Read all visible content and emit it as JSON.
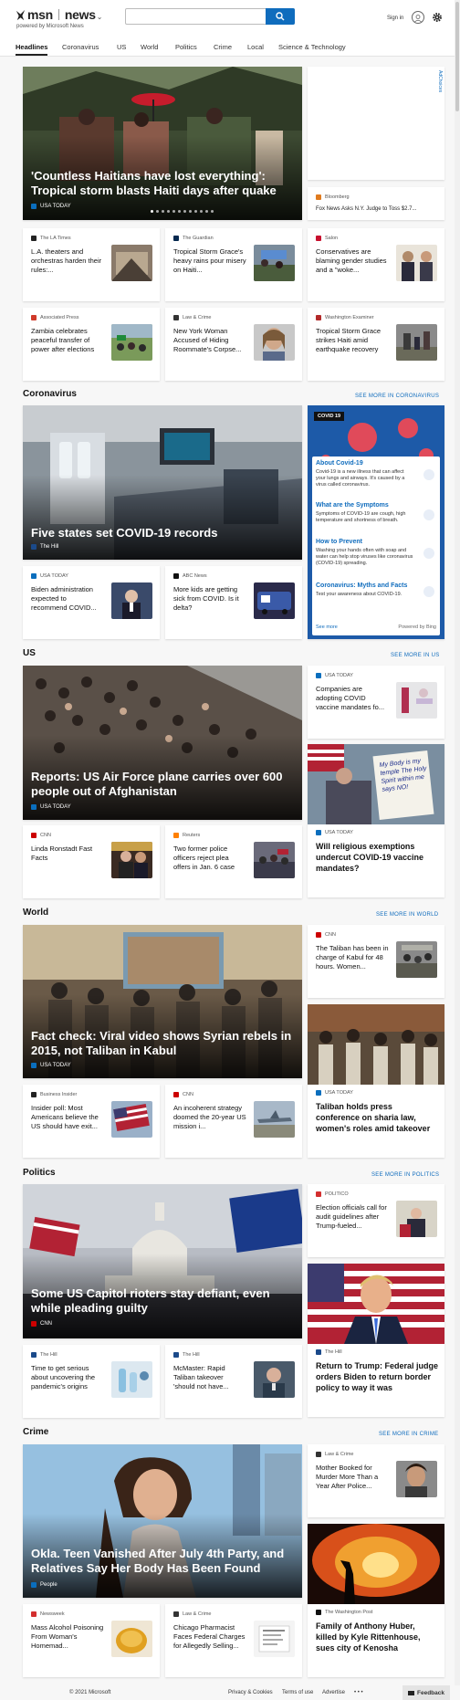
{
  "header": {
    "brand": "msn",
    "section": "news",
    "powered": "powered by Microsoft News",
    "search_placeholder": "",
    "signin": "Sign in"
  },
  "nav": [
    "Headlines",
    "Coronavirus",
    "US",
    "World",
    "Politics",
    "Crime",
    "Local",
    "Science & Technology"
  ],
  "ad_label": "AdChoices",
  "headlines": {
    "hero": {
      "title": "'Countless Haitians have lost everything': Tropical storm blasts Haiti days after quake",
      "source": "USA TODAY"
    },
    "side_top": {
      "source": "Bloomberg",
      "title": "Fox News Asks N.Y. Judge to Toss $2.7..."
    },
    "row1": [
      {
        "source": "The LA Times",
        "title": "L.A. theaters and orchestras harden their rules:..."
      },
      {
        "source": "The Guardian",
        "title": "Tropical Storm Grace's heavy rains pour misery on Haiti..."
      },
      {
        "source": "Salon",
        "title": "Conservatives are blaming gender studies and a \"woke..."
      }
    ],
    "row2": [
      {
        "source": "Associated Press",
        "title": "Zambia celebrates peaceful transfer of power after elections"
      },
      {
        "source": "Law & Crime",
        "title": "New York Woman Accused of Hiding Roommate's Corpse..."
      },
      {
        "source": "Washington Examiner",
        "title": "Tropical Storm Grace strikes Haiti amid earthquake recovery"
      }
    ]
  },
  "coronavirus": {
    "heading": "Coronavirus",
    "see_more": "SEE MORE IN CORONAVIRUS",
    "hero": {
      "title": "Five states set COVID-19 records",
      "source": "The Hill"
    },
    "panel": {
      "badge": "COVID 19",
      "items": [
        {
          "title": "About Covid-19",
          "text": "Covid-19 is a new illness that can affect your lungs and airways. It's caused by a virus called coronavirus."
        },
        {
          "title": "What are the Symptoms",
          "text": "Symptoms of COVID-19 are cough, high temperature and shortness of breath."
        },
        {
          "title": "How to Prevent",
          "text": "Washing your hands often with soap and water can help stop viruses like coronavirus (COVID-19) spreading."
        },
        {
          "title": "Coronavirus: Myths and Facts",
          "text": "Test your awareness about COVID-19."
        }
      ],
      "see_more": "See more",
      "powered": "Powered by Bing"
    },
    "row": [
      {
        "source": "USA TODAY",
        "title": "Biden administration expected to recommend COVID..."
      },
      {
        "source": "ABC News",
        "title": "More kids are getting sick from COVID. Is it delta?"
      }
    ]
  },
  "us": {
    "heading": "US",
    "see_more": "SEE MORE IN US",
    "hero": {
      "title": "Reports: US Air Force plane carries over 600 people out of Afghanistan",
      "source": "USA TODAY"
    },
    "side_top": {
      "source": "USA TODAY",
      "title": "Companies are adopting COVID vaccine mandates fo..."
    },
    "tall": {
      "source": "USA TODAY",
      "title": "Will religious exemptions undercut COVID-19 vaccine mandates?",
      "sign_text": "My Body is my temple The Holy Spirit within me says NO!"
    },
    "row": [
      {
        "source": "CNN",
        "title": "Linda Ronstadt Fast Facts"
      },
      {
        "source": "Reuters",
        "title": "Two former police officers reject plea offers in Jan. 6 case"
      }
    ]
  },
  "world": {
    "heading": "World",
    "see_more": "SEE MORE IN WORLD",
    "hero": {
      "title": "Fact check: Viral video shows Syrian rebels in 2015, not Taliban in Kabul",
      "source": "USA TODAY"
    },
    "side_top": {
      "source": "CNN",
      "title": "The Taliban has been in charge of Kabul for 48 hours. Women..."
    },
    "tall": {
      "source": "USA TODAY",
      "title": "Taliban holds press conference on sharia law, women's roles amid takeover"
    },
    "row": [
      {
        "source": "Business Insider",
        "title": "Insider poll: Most Americans believe the US should have exit..."
      },
      {
        "source": "CNN",
        "title": "An incoherent strategy doomed the 20-year US mission i..."
      }
    ]
  },
  "politics": {
    "heading": "Politics",
    "see_more": "SEE MORE IN POLITICS",
    "hero": {
      "title": "Some US Capitol rioters stay defiant, even while pleading guilty",
      "source": "CNN"
    },
    "side_top": {
      "source": "POLITICO",
      "title": "Election officials call for audit guidelines after Trump-fueled..."
    },
    "tall": {
      "source": "The Hill",
      "title": "Return to Trump: Federal judge orders Biden to return border policy to way it was"
    },
    "row": [
      {
        "source": "The Hill",
        "title": "Time to get serious about uncovering the pandemic's origins"
      },
      {
        "source": "The Hill",
        "title": "McMaster: Rapid Taliban takeover 'should not have..."
      }
    ]
  },
  "crime": {
    "heading": "Crime",
    "see_more": "SEE MORE IN CRIME",
    "hero": {
      "title": "Okla. Teen Vanished After July 4th Party, and Relatives Say Her Body Has Been Found",
      "source": "People"
    },
    "side_top": {
      "source": "Law & Crime",
      "title": "Mother Booked for Murder More Than a Year After Police..."
    },
    "tall": {
      "source": "The Washington Post",
      "title": "Family of Anthony Huber, killed by Kyle Rittenhouse, sues city of Kenosha"
    },
    "row": [
      {
        "source": "Newsweek",
        "title": "Mass Alcohol Poisoning From Woman's Homemad..."
      },
      {
        "source": "Law & Crime",
        "title": "Chicago Pharmacist Faces Federal Charges for Allegedly Selling..."
      }
    ]
  },
  "footer": {
    "copyright": "© 2021 Microsoft",
    "privacy": "Privacy & Cookies",
    "terms": "Terms of use",
    "advertise": "Advertise",
    "more": "• • •",
    "feedback": "Feedback"
  }
}
